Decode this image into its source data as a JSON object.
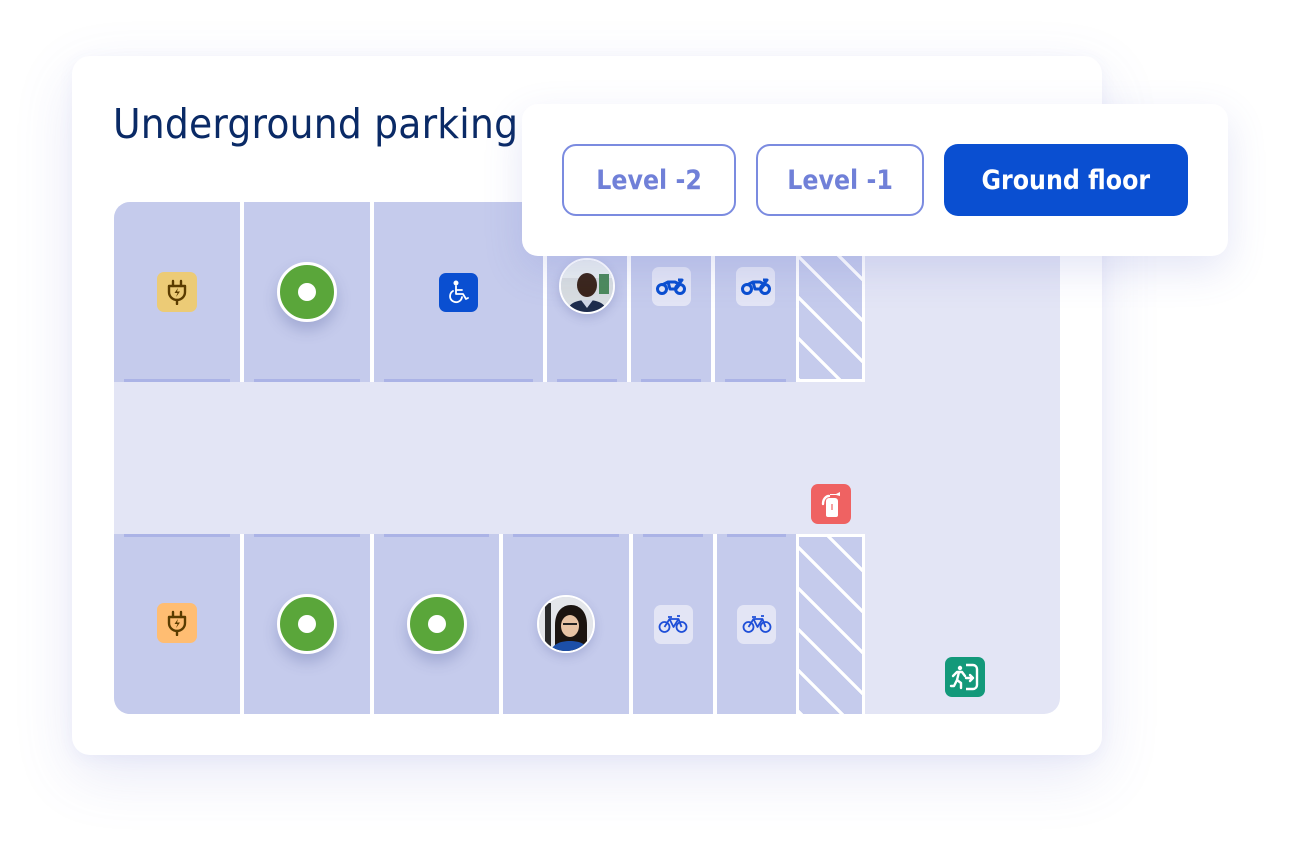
{
  "page": {
    "title": "Underground parking"
  },
  "levels": {
    "options": [
      {
        "label": "Level -2",
        "selected": false
      },
      {
        "label": "Level -1",
        "selected": false
      },
      {
        "label": "Ground floor",
        "selected": true
      }
    ]
  },
  "map": {
    "top_row": [
      {
        "type": "ev-charging",
        "icon": "ev-plug-icon",
        "status": "charging-spot"
      },
      {
        "type": "free",
        "icon": "available-spot-icon",
        "status": "available"
      },
      {
        "type": "accessible",
        "icon": "wheelchair-icon",
        "status": "accessible-spot"
      },
      {
        "type": "occupied",
        "icon": "avatar",
        "status": "booked"
      },
      {
        "type": "motorcycle",
        "icon": "motorcycle-icon",
        "status": "motorcycle-spot"
      },
      {
        "type": "motorcycle",
        "icon": "motorcycle-icon",
        "status": "motorcycle-spot"
      },
      {
        "type": "blocked",
        "icon": "hatched-area",
        "status": "unavailable"
      }
    ],
    "bottom_row": [
      {
        "type": "ev-charging",
        "icon": "ev-plug-icon",
        "status": "charging-spot"
      },
      {
        "type": "free",
        "icon": "available-spot-icon",
        "status": "available"
      },
      {
        "type": "free",
        "icon": "available-spot-icon",
        "status": "available"
      },
      {
        "type": "occupied",
        "icon": "avatar",
        "status": "booked"
      },
      {
        "type": "bicycle",
        "icon": "bicycle-icon",
        "status": "bicycle-spot"
      },
      {
        "type": "bicycle",
        "icon": "bicycle-icon",
        "status": "bicycle-spot"
      },
      {
        "type": "blocked",
        "icon": "hatched-area",
        "status": "unavailable"
      }
    ],
    "landmarks": [
      {
        "type": "fire-extinguisher",
        "icon": "fire-extinguisher-icon"
      },
      {
        "type": "emergency-exit",
        "icon": "emergency-exit-icon"
      }
    ]
  },
  "colors": {
    "accent": "#0a4fd1",
    "title": "#0a2a66",
    "spot": "#c5cbec",
    "aisle": "#e3e5f5",
    "available": "#5aa63a",
    "ev_tile_top": "#eccb76",
    "ev_tile_bottom": "#ffbd72",
    "fire": "#ef6262",
    "exit": "#13997a",
    "outline_button": "#7b8be0"
  }
}
